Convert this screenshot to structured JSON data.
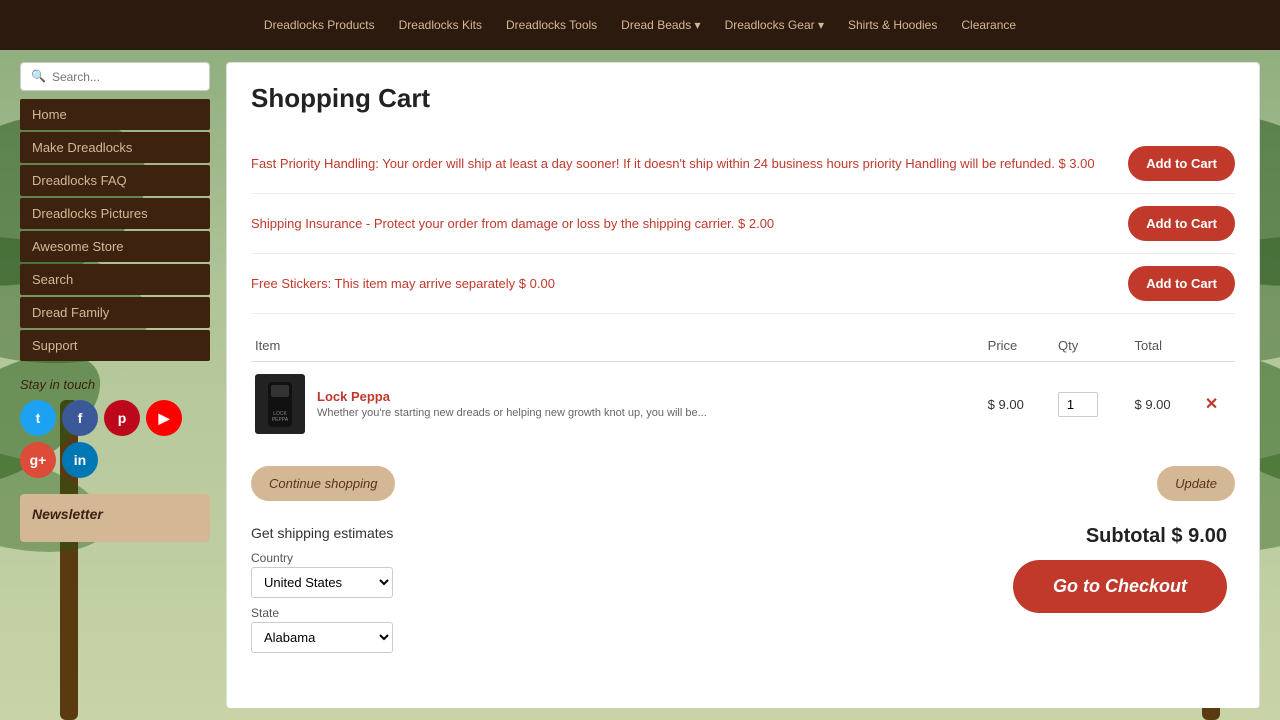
{
  "nav": {
    "items": [
      {
        "label": "Dreadlocks Products",
        "hasArrow": false
      },
      {
        "label": "Dreadlocks Kits",
        "hasArrow": false
      },
      {
        "label": "Dreadlocks Tools",
        "hasArrow": false
      },
      {
        "label": "Dread Beads",
        "hasArrow": true
      },
      {
        "label": "Dreadlocks Gear",
        "hasArrow": true
      },
      {
        "label": "Shirts & Hoodies",
        "hasArrow": false
      },
      {
        "label": "Clearance",
        "hasArrow": false
      }
    ]
  },
  "sidebar": {
    "search_placeholder": "Search...",
    "menu_items": [
      {
        "label": "Home"
      },
      {
        "label": "Make Dreadlocks"
      },
      {
        "label": "Dreadlocks FAQ"
      },
      {
        "label": "Dreadlocks Pictures"
      },
      {
        "label": "Awesome Store"
      },
      {
        "label": "Search"
      },
      {
        "label": "Dread Family"
      },
      {
        "label": "Support"
      }
    ],
    "social_title": "Stay in touch",
    "social_icons": [
      {
        "name": "Twitter",
        "symbol": "t",
        "class": "social-twitter"
      },
      {
        "name": "Facebook",
        "symbol": "f",
        "class": "social-facebook"
      },
      {
        "name": "Pinterest",
        "symbol": "p",
        "class": "social-pinterest"
      },
      {
        "name": "YouTube",
        "symbol": "▶",
        "class": "social-youtube"
      },
      {
        "name": "Google+",
        "symbol": "g+",
        "class": "social-google"
      },
      {
        "name": "LinkedIn",
        "symbol": "in",
        "class": "social-linkedin"
      }
    ],
    "newsletter_title": "Newsletter"
  },
  "cart": {
    "title": "Shopping Cart",
    "upsells": [
      {
        "text": "Fast Priority Handling: Your order will ship at least a day sooner! If it doesn't ship within 24 business hours priority Handling will be refunded. $ 3.00",
        "btn_label": "Add to Cart"
      },
      {
        "text": "Shipping Insurance - Protect your order from damage or loss by the shipping carrier. $ 2.00",
        "btn_label": "Add to Cart"
      },
      {
        "text": "Free Stickers: This item may arrive separately $ 0.00",
        "btn_label": "Add to Cart"
      }
    ],
    "table": {
      "headers": [
        "Item",
        "Price",
        "Qty",
        "Total"
      ],
      "rows": [
        {
          "img_alt": "Lock Peppa",
          "name": "Lock Peppa",
          "description": "Whether you're starting new dreads or helping new growth knot up, you will be...",
          "price": "$ 9.00",
          "qty": "1",
          "total": "$ 9.00"
        }
      ]
    },
    "continue_label": "Continue shopping",
    "update_label": "Update",
    "shipping": {
      "title": "Get shipping estimates",
      "country_label": "Country",
      "country_value": "United States",
      "state_label": "State",
      "state_value": "Alabama"
    },
    "subtotal_label": "Subtotal",
    "subtotal_amount": "$ 9.00",
    "checkout_label": "Go to Checkout"
  }
}
